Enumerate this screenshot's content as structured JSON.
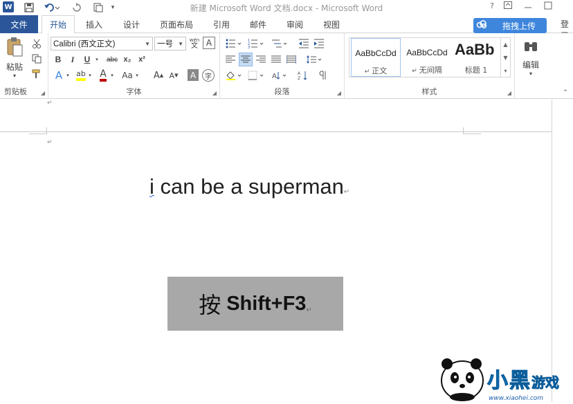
{
  "window": {
    "title": "新建 Microsoft Word 文档.docx - Microsoft Word",
    "app_logo": "W"
  },
  "tabs": {
    "file": "文件",
    "items": [
      "开始",
      "插入",
      "设计",
      "页面布局",
      "引用",
      "邮件",
      "审阅",
      "视图"
    ],
    "active": "开始",
    "upload": "拖拽上传",
    "login": "登录"
  },
  "ribbon": {
    "clipboard": {
      "label": "剪贴板",
      "paste": "粘贴"
    },
    "font": {
      "label": "字体",
      "name": "Calibri (西文正文)",
      "size": "一号",
      "pinyin": "wén",
      "pinyin_char": "文",
      "bold": "B",
      "italic": "I",
      "underline": "U",
      "strike": "abc",
      "sub": "x₂",
      "sup": "x²",
      "effects": "A",
      "highlight": "ab",
      "color": "A",
      "case": "Aa",
      "grow": "A",
      "shrink": "A",
      "char_shading": "A",
      "enclose": "字"
    },
    "paragraph": {
      "label": "段落"
    },
    "styles": {
      "label": "样式",
      "items": [
        {
          "sample": "AaBbCcDd",
          "name": "正文"
        },
        {
          "sample": "AaBbCcDd",
          "name": "无间隔"
        },
        {
          "sample": "AaBb",
          "name": "标题 1"
        }
      ]
    },
    "editing": {
      "label": "编辑"
    }
  },
  "document": {
    "body_first_word": "i",
    "body_rest": " can be a superman",
    "paragraph_mark": "↵"
  },
  "overlay": {
    "hint_prefix": "按",
    "hint_keys": "Shift+F3"
  },
  "watermark": {
    "brand": "小黑游戏",
    "url": "www.xiaohei.com"
  },
  "colors": {
    "word_blue": "#2b579a",
    "upload_blue": "#3e86dc",
    "hint_box": "#a8a8a8"
  }
}
